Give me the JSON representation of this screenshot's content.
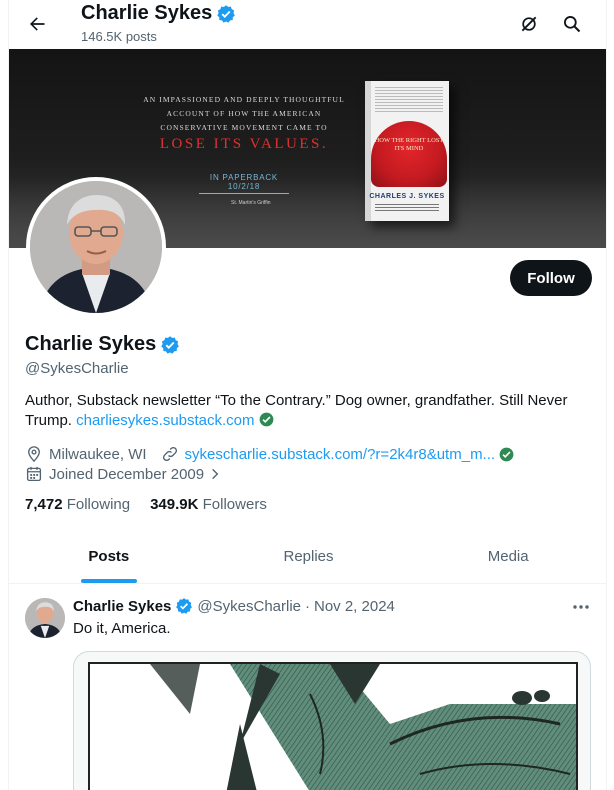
{
  "header": {
    "name": "Charlie Sykes",
    "posts_count": "146.5K posts",
    "icons": [
      "back-arrow-icon",
      "grok-icon",
      "search-icon"
    ]
  },
  "banner": {
    "line1": "AN IMPASSIONED AND DEEPLY THOUGHTFUL",
    "line2": "ACCOUNT OF HOW THE AMERICAN",
    "line3": "CONSERVATIVE MOVEMENT CAME TO",
    "headline": "LOSE ITS VALUES.",
    "paperback": "IN PAPERBACK 10/2/18",
    "publisher": "St. Martin's Griffin",
    "book_cap_text": "HOW THE RIGHT LOST ITS MIND",
    "book_author": "CHARLES J. SYKES",
    "cap_color": "#c21a20",
    "headline_color": "#e0312f"
  },
  "profile": {
    "name": "Charlie Sykes",
    "handle": "@SykesCharlie",
    "verified": true,
    "follow_label": "Follow",
    "bio_text": "Author, Substack newsletter “To the Contrary.” Dog owner, grandfather. Still Never Trump.",
    "bio_link": "charliesykes.substack.com",
    "location": "Milwaukee, WI",
    "website": "sykescharlie.substack.com/?r=2k4r8&utm_m...",
    "joined": "Joined December 2009",
    "following_count": "7,472",
    "following_label": "Following",
    "followers_count": "349.9K",
    "followers_label": "Followers"
  },
  "tabs": [
    {
      "label": "Posts",
      "active": true
    },
    {
      "label": "Replies",
      "active": false
    },
    {
      "label": "Media",
      "active": false
    }
  ],
  "tweet": {
    "name": "Charlie Sykes",
    "handle": "@SykesCharlie",
    "separator": "·",
    "date": "Nov 2, 2024",
    "text": "Do it, America."
  },
  "colors": {
    "accent": "#1d9bf0",
    "text": "#0f1419",
    "secondary": "#536471",
    "verified_link_check": "#2e8a52"
  }
}
